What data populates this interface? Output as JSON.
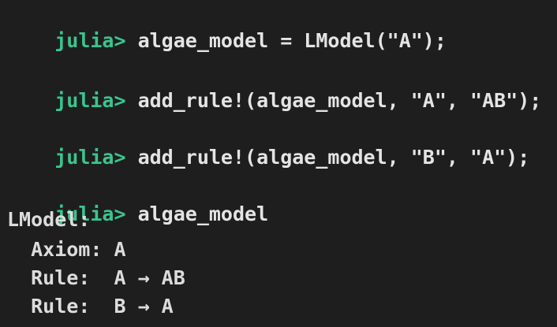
{
  "terminal": {
    "prompt": "julia> ",
    "commands": [
      "algae_model = LModel(\"A\");",
      "add_rule!(algae_model, \"A\", \"AB\");",
      "add_rule!(algae_model, \"B\", \"A\");",
      "algae_model"
    ],
    "output": [
      "LModel:",
      "  Axiom: A",
      "  Rule:  A → AB",
      "  Rule:  B → A"
    ]
  },
  "colors": {
    "background": "#1e1e1e",
    "prompt": "#3bc48d",
    "text": "#e4e4e4"
  }
}
